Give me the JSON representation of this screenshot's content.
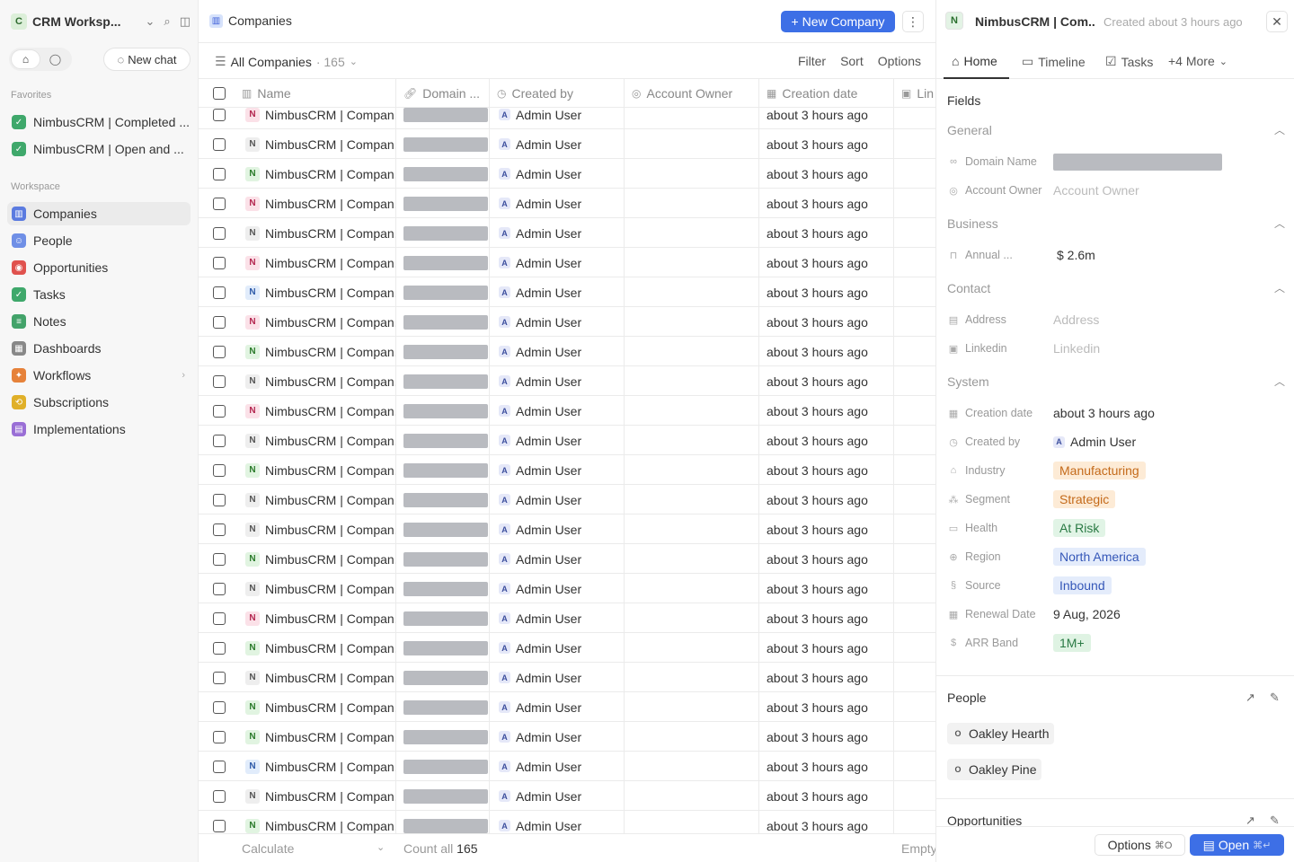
{
  "sidebar": {
    "workspace": {
      "badge": "C",
      "name": "CRM Worksp..."
    },
    "new_chat": "New chat",
    "favorites_label": "Favorites",
    "favorites": [
      {
        "label": "NimbusCRM | Completed ..."
      },
      {
        "label": "NimbusCRM | Open and ..."
      }
    ],
    "workspace_label": "Workspace",
    "items": [
      {
        "label": "Companies",
        "icon": "building-icon",
        "color": "#5b7be0",
        "active": true
      },
      {
        "label": "People",
        "icon": "person-icon",
        "color": "#6f8fe6"
      },
      {
        "label": "Opportunities",
        "icon": "target-icon",
        "color": "#e0524e"
      },
      {
        "label": "Tasks",
        "icon": "checkbox-icon",
        "color": "#3fa86b"
      },
      {
        "label": "Notes",
        "icon": "note-icon",
        "color": "#43a36a"
      },
      {
        "label": "Dashboards",
        "icon": "dashboard-icon",
        "color": "#888888"
      },
      {
        "label": "Workflows",
        "icon": "workflow-icon",
        "color": "#e6823a"
      },
      {
        "label": "Subscriptions",
        "icon": "repeat-icon",
        "color": "#e0b028"
      },
      {
        "label": "Implementations",
        "icon": "clipboard-icon",
        "color": "#9a6fd6"
      }
    ]
  },
  "main": {
    "title": "Companies",
    "new_button": "New Company",
    "view": {
      "name": "All Companies",
      "count": "· 165"
    },
    "actions": [
      "Filter",
      "Sort",
      "Options"
    ],
    "columns": [
      {
        "label": "Name",
        "icon": "building-icon"
      },
      {
        "label": "Domain ...",
        "icon": "link-icon"
      },
      {
        "label": "Created by",
        "icon": "history-icon"
      },
      {
        "label": "Account Owner",
        "icon": "user-circle-icon"
      },
      {
        "label": "Creation date",
        "icon": "calendar-icon"
      },
      {
        "label": "Lin",
        "icon": "linkedin-icon"
      }
    ],
    "row_template": {
      "name": "NimbusCRM | Compan...",
      "badge": "N",
      "created_by_badge": "A",
      "created_by": "Admin User",
      "created": "about 3 hours ago"
    },
    "row_badge_colors": [
      "pink",
      "gray",
      "green",
      "pink",
      "gray",
      "pink",
      "blue",
      "pink",
      "green",
      "gray",
      "pink",
      "gray",
      "green",
      "gray",
      "gray",
      "green",
      "gray",
      "pink",
      "green",
      "gray",
      "green",
      "green",
      "blue",
      "gray",
      "green"
    ],
    "footer": {
      "calculate": "Calculate",
      "count_label": "Count all",
      "count_value": "165",
      "empty": "Empty"
    }
  },
  "panel": {
    "badge": "N",
    "title": "NimbusCRM | Com...",
    "subtitle": "Created about 3 hours ago",
    "tabs": [
      {
        "label": "Home",
        "icon": "home-icon"
      },
      {
        "label": "Timeline",
        "icon": "timeline-icon"
      },
      {
        "label": "Tasks",
        "icon": "checkbox-icon"
      },
      {
        "label": "+4 More",
        "icon": "chevron-down-icon"
      }
    ],
    "fields_title": "Fields",
    "groups": {
      "general": "General",
      "business": "Business",
      "contact": "Contact",
      "system": "System"
    },
    "fields": {
      "domain_name": {
        "label": "Domain Name"
      },
      "account_owner": {
        "label": "Account Owner",
        "placeholder": "Account Owner"
      },
      "annual": {
        "label": "Annual ...",
        "value": "$ 2.6m"
      },
      "address": {
        "label": "Address",
        "placeholder": "Address"
      },
      "linkedin": {
        "label": "Linkedin",
        "placeholder": "Linkedin"
      },
      "creation_date": {
        "label": "Creation date",
        "value": "about 3 hours ago"
      },
      "created_by": {
        "label": "Created by",
        "badge": "A",
        "value": "Admin User"
      },
      "industry": {
        "label": "Industry",
        "value": "Manufacturing"
      },
      "segment": {
        "label": "Segment",
        "value": "Strategic"
      },
      "health": {
        "label": "Health",
        "value": "At Risk"
      },
      "region": {
        "label": "Region",
        "value": "North America"
      },
      "source": {
        "label": "Source",
        "value": "Inbound"
      },
      "renewal_date": {
        "label": "Renewal Date",
        "value": "9 Aug, 2026"
      },
      "arr_band": {
        "label": "ARR Band",
        "value": "1M+"
      }
    },
    "people_title": "People",
    "people": [
      {
        "badge": "O",
        "name": "Oakley Hearth"
      },
      {
        "badge": "O",
        "name": "Oakley Pine"
      }
    ],
    "opportunities_title": "Opportunities",
    "options_button": "Options",
    "options_kbd": "⌘O",
    "open_button": "Open",
    "open_kbd": "⌘↵",
    "colors": {
      "accent": "#3d6fe6",
      "industry_bg": "#fdebd6",
      "industry_fg": "#c46a1a",
      "health_bg": "#e1f4e6",
      "health_fg": "#2a7a44",
      "region_bg": "#e4ecfb",
      "region_fg": "#3557b8",
      "arr_bg": "#dff3e3",
      "arr_fg": "#2a7a44"
    }
  }
}
